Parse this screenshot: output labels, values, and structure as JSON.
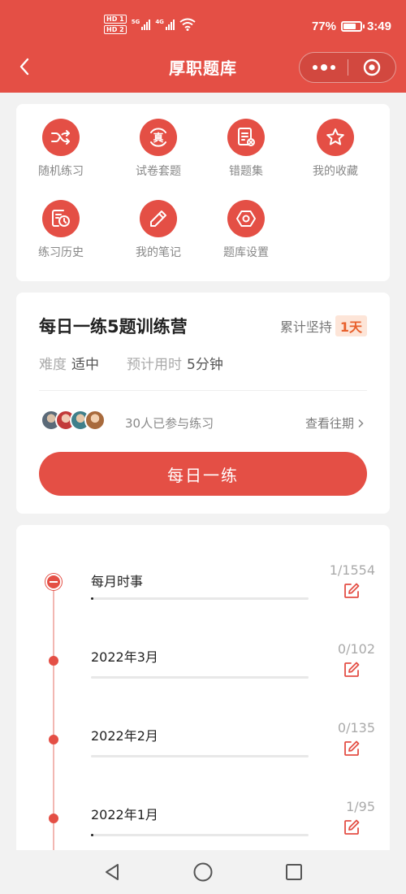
{
  "status_bar": {
    "hd1": "HD 1",
    "hd2": "HD 2",
    "net1": "5G",
    "net2": "4G",
    "battery_percent": "77%",
    "battery_level": 0.77,
    "time": "3:49"
  },
  "header": {
    "title": "厚职题库"
  },
  "features": [
    {
      "label": "随机练习",
      "icon": "shuffle-icon"
    },
    {
      "label": "试卷套题",
      "icon": "exam-paper-icon"
    },
    {
      "label": "错题集",
      "icon": "wrong-questions-icon"
    },
    {
      "label": "我的收藏",
      "icon": "star-icon"
    },
    {
      "label": "练习历史",
      "icon": "history-icon"
    },
    {
      "label": "我的笔记",
      "icon": "pencil-icon"
    },
    {
      "label": "题库设置",
      "icon": "settings-hexagon-icon"
    }
  ],
  "daily": {
    "title": "每日一练5题训练营",
    "streak_label": "累计坚持",
    "streak_value": "1天",
    "difficulty_label": "难度",
    "difficulty_value": "适中",
    "time_label": "预计用时",
    "time_value": "5分钟",
    "participants": "30人已参与练习",
    "history_link": "查看往期",
    "cta": "每日一练"
  },
  "categories": [
    {
      "label": "每月时事",
      "count": "1/1554",
      "progress": 0.0006,
      "expanded": true
    },
    {
      "label": "2022年3月",
      "count": "0/102",
      "progress": 0,
      "expanded": false
    },
    {
      "label": "2022年2月",
      "count": "0/135",
      "progress": 0,
      "expanded": false
    },
    {
      "label": "2022年1月",
      "count": "1/95",
      "progress": 0.0105,
      "expanded": false
    }
  ],
  "colors": {
    "accent": "#e44f45",
    "streak_bg": "#fde5d8",
    "streak_text": "#e8602c"
  }
}
